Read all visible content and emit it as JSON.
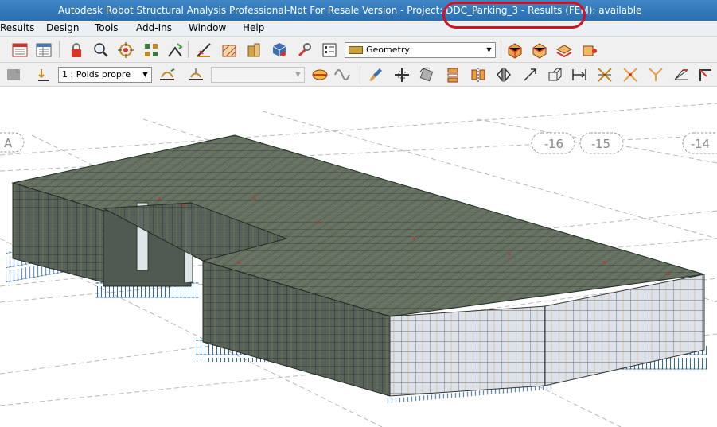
{
  "window": {
    "title": "Autodesk Robot Structural Analysis Professional-Not For Resale Version - Project: DDC_Parking_3 - Results (FEM): available"
  },
  "menu": {
    "items": [
      "Results",
      "Design",
      "Tools",
      "Add-Ins",
      "Window",
      "Help"
    ]
  },
  "toolbar": {
    "layout_select": "Geometry",
    "load_case_select": "1 : Poids propre",
    "second_select": ""
  },
  "viewport": {
    "grid_labels": [
      "A",
      "16",
      "15",
      "14"
    ]
  },
  "colors": {
    "annotation": "#d80f1c",
    "mesh_top": "#607060",
    "mesh_side": "#556155",
    "mesh_light": "#d9dde6",
    "supports": "#2f6aa0"
  }
}
